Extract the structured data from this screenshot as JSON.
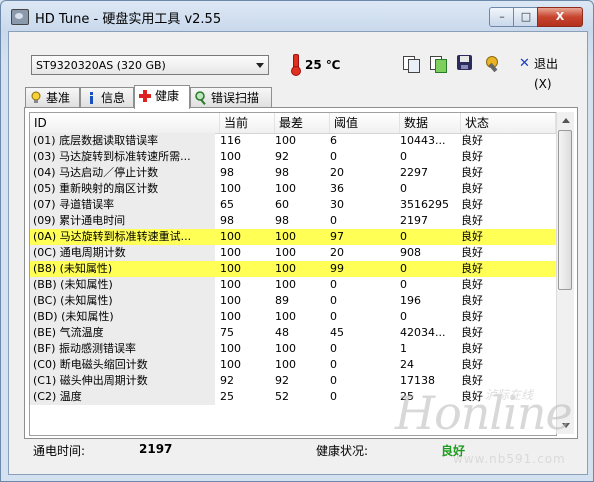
{
  "window": {
    "title": "HD Tune - 硬盘实用工具 v2.55",
    "controls": {
      "minimize": "–",
      "maximize": "□",
      "close": "X"
    }
  },
  "toolbar": {
    "drive": "ST9320320AS (320 GB)",
    "temperature": "25 ℃",
    "exit_label": "退出(X)",
    "icons": [
      "copy-text-icon",
      "copy-screenshot-icon",
      "save-icon",
      "options-icon"
    ]
  },
  "tabs": [
    {
      "label": "基准",
      "icon": "lightbulb-icon",
      "active": false
    },
    {
      "label": "信息",
      "icon": "info-icon",
      "active": false
    },
    {
      "label": "健康",
      "icon": "health-cross-icon",
      "active": true
    },
    {
      "label": "错误扫描",
      "icon": "magnifier-icon",
      "active": false
    }
  ],
  "table": {
    "headers": {
      "id": "ID",
      "current": "当前",
      "worst": "最差",
      "threshold": "阈值",
      "data": "数据",
      "status": "状态"
    },
    "rows": [
      {
        "id": "(01) 底层数据读取错误率",
        "current": "116",
        "worst": "100",
        "threshold": "6",
        "data": "10443...",
        "status": "良好",
        "highlight": false
      },
      {
        "id": "(03) 马达旋转到标准转速所需...",
        "current": "100",
        "worst": "92",
        "threshold": "0",
        "data": "0",
        "status": "良好",
        "highlight": false
      },
      {
        "id": "(04) 马达启动／停止计数",
        "current": "98",
        "worst": "98",
        "threshold": "20",
        "data": "2297",
        "status": "良好",
        "highlight": false
      },
      {
        "id": "(05) 重新映射的扇区计数",
        "current": "100",
        "worst": "100",
        "threshold": "36",
        "data": "0",
        "status": "良好",
        "highlight": false
      },
      {
        "id": "(07) 寻道错误率",
        "current": "65",
        "worst": "60",
        "threshold": "30",
        "data": "3516295",
        "status": "良好",
        "highlight": false
      },
      {
        "id": "(09) 累计通电时间",
        "current": "98",
        "worst": "98",
        "threshold": "0",
        "data": "2197",
        "status": "良好",
        "highlight": false
      },
      {
        "id": "(0A) 马达旋转到标准转速重试...",
        "current": "100",
        "worst": "100",
        "threshold": "97",
        "data": "0",
        "status": "良好",
        "highlight": true
      },
      {
        "id": "(0C) 通电周期计数",
        "current": "100",
        "worst": "100",
        "threshold": "20",
        "data": "908",
        "status": "良好",
        "highlight": false
      },
      {
        "id": "(B8) (未知属性)",
        "current": "100",
        "worst": "100",
        "threshold": "99",
        "data": "0",
        "status": "良好",
        "highlight": true
      },
      {
        "id": "(BB) (未知属性)",
        "current": "100",
        "worst": "100",
        "threshold": "0",
        "data": "0",
        "status": "良好",
        "highlight": false
      },
      {
        "id": "(BC) (未知属性)",
        "current": "100",
        "worst": "89",
        "threshold": "0",
        "data": "196",
        "status": "良好",
        "highlight": false
      },
      {
        "id": "(BD) (未知属性)",
        "current": "100",
        "worst": "100",
        "threshold": "0",
        "data": "0",
        "status": "良好",
        "highlight": false
      },
      {
        "id": "(BE) 气流温度",
        "current": "75",
        "worst": "48",
        "threshold": "45",
        "data": "42034...",
        "status": "良好",
        "highlight": false
      },
      {
        "id": "(BF) 振动感测错误率",
        "current": "100",
        "worst": "100",
        "threshold": "0",
        "data": "1",
        "status": "良好",
        "highlight": false
      },
      {
        "id": "(C0) 断电磁头缩回计数",
        "current": "100",
        "worst": "100",
        "threshold": "0",
        "data": "24",
        "status": "良好",
        "highlight": false
      },
      {
        "id": "(C1) 磁头伸出周期计数",
        "current": "92",
        "worst": "92",
        "threshold": "0",
        "data": "17138",
        "status": "良好",
        "highlight": false
      },
      {
        "id": "(C2) 温度",
        "current": "25",
        "worst": "52",
        "threshold": "0",
        "data": "25",
        "status": "良好",
        "highlight": false
      }
    ]
  },
  "status": {
    "power_on_label": "通电时间:",
    "power_on_value": "2197",
    "health_label": "健康状况:",
    "health_value": "良好"
  },
  "watermark": {
    "script": "Honline",
    "cn": "泸际在线",
    "url": "www.nb591.com"
  },
  "colors": {
    "highlight": "#ffff55",
    "health_ok": "#1f9b1f",
    "close_button": "#c7442e"
  }
}
